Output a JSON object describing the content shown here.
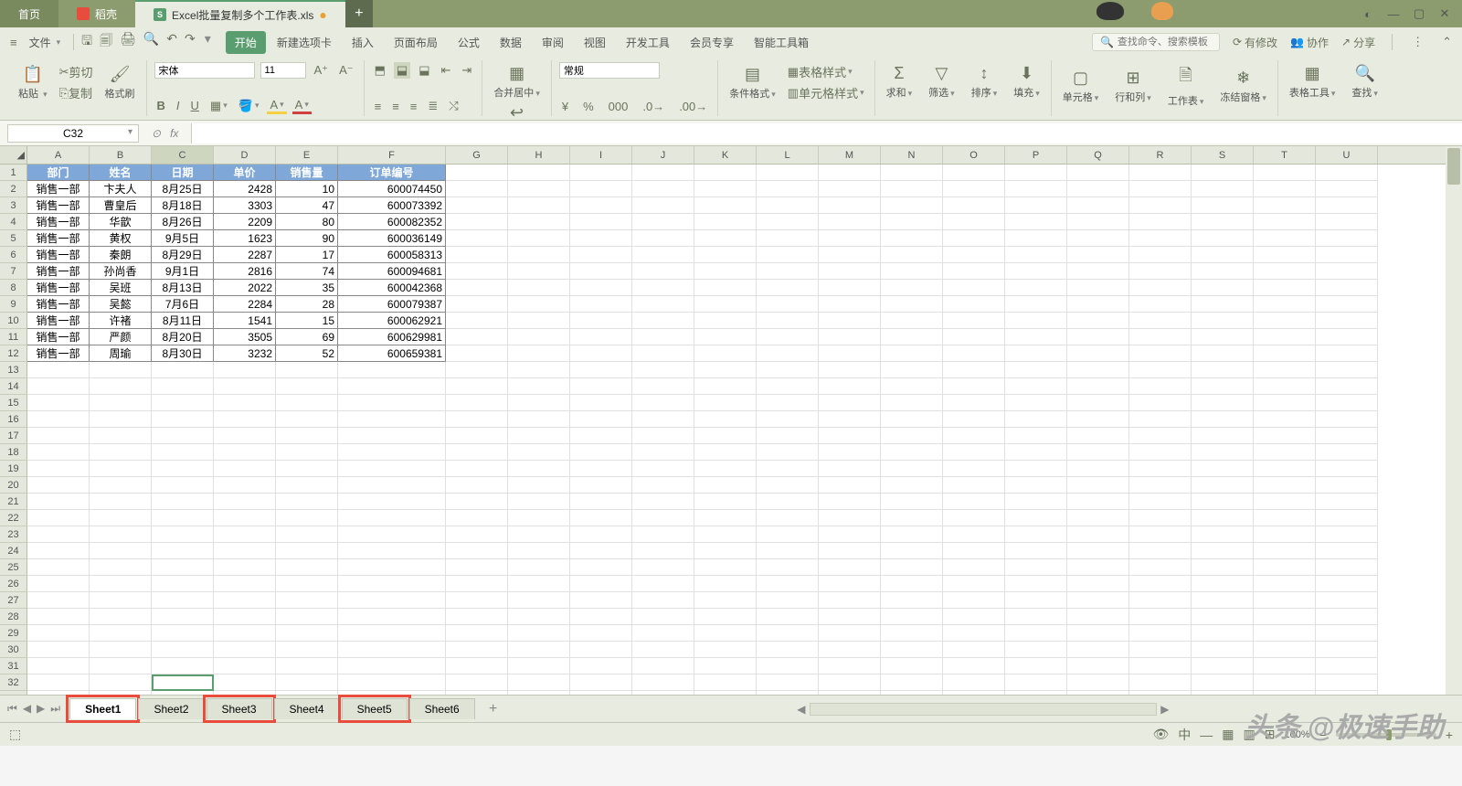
{
  "title": {
    "home": "首页",
    "doke": "稻壳",
    "doc": "Excel批量复制多个工作表.xls"
  },
  "menu": {
    "file": "文件",
    "tabs": [
      "开始",
      "新建选项卡",
      "插入",
      "页面布局",
      "公式",
      "数据",
      "审阅",
      "视图",
      "开发工具",
      "会员专享",
      "智能工具箱"
    ],
    "search_ph": "查找命令、搜索模板",
    "changes": "有修改",
    "collab": "协作",
    "share": "分享"
  },
  "ribbon": {
    "paste": "粘贴",
    "cut": "剪切",
    "copy": "复制",
    "brush": "格式刷",
    "font": "宋体",
    "size": "11",
    "merge": "合并居中",
    "wrap": "自动换行",
    "numfmt": "常规",
    "condfmt": "条件格式",
    "tblstyle": "表格样式",
    "cellstyle": "单元格样式",
    "sum": "求和",
    "filter": "筛选",
    "sort": "排序",
    "fill": "填充",
    "cell": "单元格",
    "rowcol": "行和列",
    "ws": "工作表",
    "freeze": "冻结窗格",
    "tbltool": "表格工具",
    "find": "查找",
    "currency": "¥",
    "pct": "%",
    "thou": "000",
    ".0+": ".0",
    ".0-": ".00"
  },
  "cellref": "C32",
  "cols": [
    "A",
    "B",
    "C",
    "D",
    "E",
    "F",
    "G",
    "H",
    "I",
    "J",
    "K",
    "L",
    "M",
    "N",
    "O",
    "P",
    "Q",
    "R",
    "S",
    "T",
    "U"
  ],
  "headers": [
    "部门",
    "姓名",
    "日期",
    "单价",
    "销售量",
    "订单编号"
  ],
  "rows": [
    [
      "销售一部",
      "卞夫人",
      "8月25日",
      "2428",
      "10",
      "600074450"
    ],
    [
      "销售一部",
      "曹皇后",
      "8月18日",
      "3303",
      "47",
      "600073392"
    ],
    [
      "销售一部",
      "华歆",
      "8月26日",
      "2209",
      "80",
      "600082352"
    ],
    [
      "销售一部",
      "黄权",
      "9月5日",
      "1623",
      "90",
      "600036149"
    ],
    [
      "销售一部",
      "秦朗",
      "8月29日",
      "2287",
      "17",
      "600058313"
    ],
    [
      "销售一部",
      "孙尚香",
      "9月1日",
      "2816",
      "74",
      "600094681"
    ],
    [
      "销售一部",
      "吴班",
      "8月13日",
      "2022",
      "35",
      "600042368"
    ],
    [
      "销售一部",
      "吴懿",
      "7月6日",
      "2284",
      "28",
      "600079387"
    ],
    [
      "销售一部",
      "许褚",
      "8月11日",
      "1541",
      "15",
      "600062921"
    ],
    [
      "销售一部",
      "严颜",
      "8月20日",
      "3505",
      "69",
      "600629981"
    ],
    [
      "销售一部",
      "周瑜",
      "8月30日",
      "3232",
      "52",
      "600659381"
    ]
  ],
  "sheets": [
    "Sheet1",
    "Sheet2",
    "Sheet3",
    "Sheet4",
    "Sheet5",
    "Sheet6"
  ],
  "status": {
    "zoom": "100%"
  },
  "watermark": "头条 @极速手助"
}
